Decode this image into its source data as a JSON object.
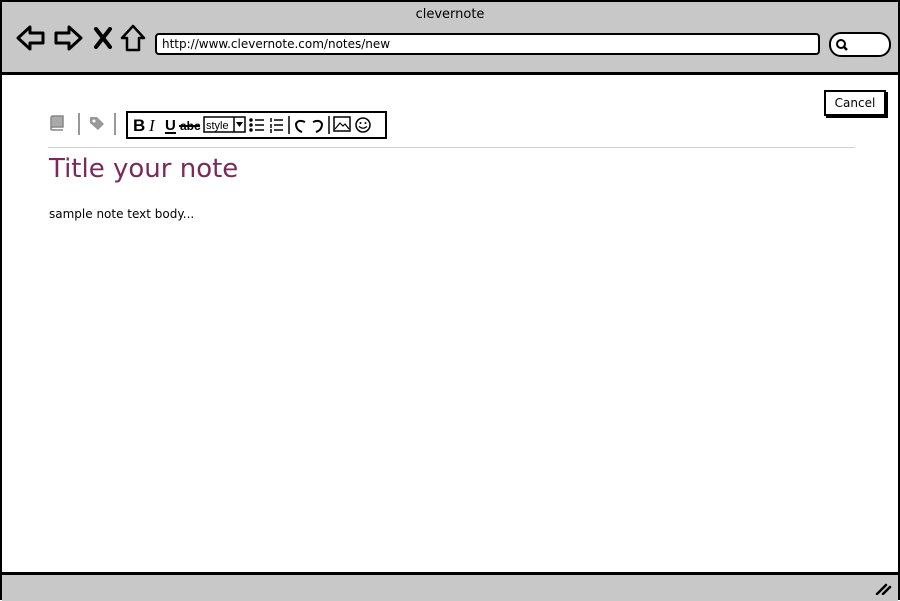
{
  "window": {
    "title": "clevernote"
  },
  "browser": {
    "url": "http://www.clevernote.com/notes/new",
    "search_icon": "search-icon",
    "nav_icons": [
      "back-icon",
      "forward-icon",
      "stop-icon",
      "home-icon"
    ]
  },
  "actions": {
    "cancel_label": "Cancel"
  },
  "editor": {
    "toolbar_icons": [
      "notebook-icon",
      "tag-icon"
    ],
    "format_buttons": [
      "B",
      "I",
      "U",
      "strike",
      "style",
      "bullets",
      "numbering",
      "undo",
      "redo",
      "image",
      "emoji"
    ],
    "style_label": "style",
    "title_placeholder": "Title your note",
    "body_text": "sample note text body..."
  },
  "colors": {
    "title": "#7a2a5a",
    "chrome": "#c8c8c8"
  }
}
